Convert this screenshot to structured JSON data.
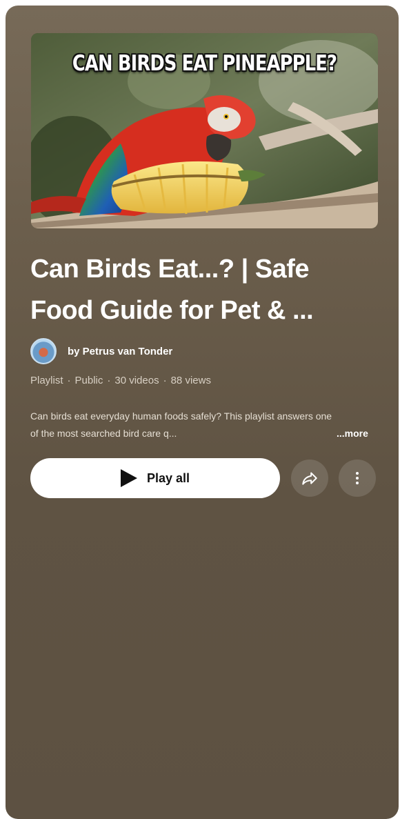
{
  "playlist": {
    "thumbnail_caption": "CAN BIRDS EAT PINEAPPLE?",
    "title": "Can Birds Eat...? | Safe Food Guide for Pet & ...",
    "owner": "by Petrus van Tonder",
    "meta": {
      "type": "Playlist",
      "visibility": "Public",
      "video_count": "30 videos",
      "views": "88 views",
      "separator": "·"
    },
    "description": "Can birds eat everyday human foods safely? This playlist answers one of the most searched bird care q...",
    "more_label": "...more"
  },
  "actions": {
    "play_all_label": "Play all",
    "share_icon": "share-icon",
    "more_icon": "more-vert-icon"
  },
  "colors": {
    "card_background": "#6a5d4b",
    "button_background": "#ffffff",
    "text_primary": "#ffffff"
  }
}
